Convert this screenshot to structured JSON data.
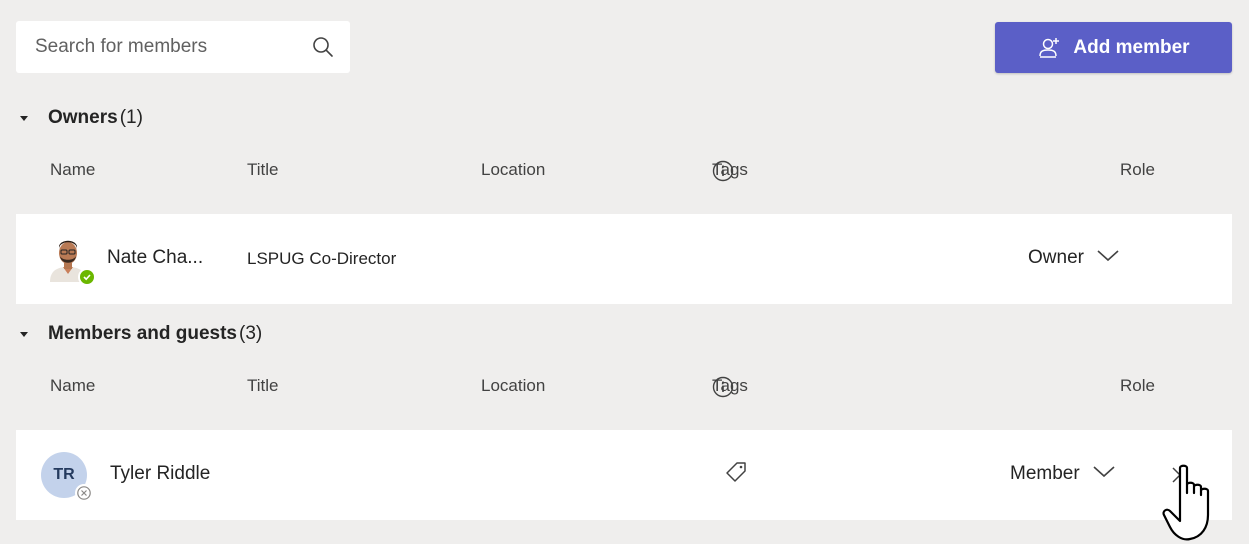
{
  "search": {
    "placeholder": "Search for members"
  },
  "toolbar": {
    "add_member_label": "Add member"
  },
  "columns": {
    "name": "Name",
    "title": "Title",
    "location": "Location",
    "tags": "Tags",
    "role": "Role"
  },
  "owners": {
    "label": "Owners",
    "count": "(1)",
    "rows": [
      {
        "name": "Nate Cha...",
        "title": "LSPUG Co-Director",
        "role": "Owner",
        "status": "available"
      }
    ]
  },
  "members": {
    "label": "Members and guests",
    "count": "(3)",
    "rows": [
      {
        "initials": "TR",
        "name": "Tyler Riddle",
        "title": "",
        "role": "Member",
        "status": "offline"
      }
    ]
  },
  "colors": {
    "accent": "#5b5fc7",
    "background": "#efeeed",
    "available": "#6bb700"
  }
}
